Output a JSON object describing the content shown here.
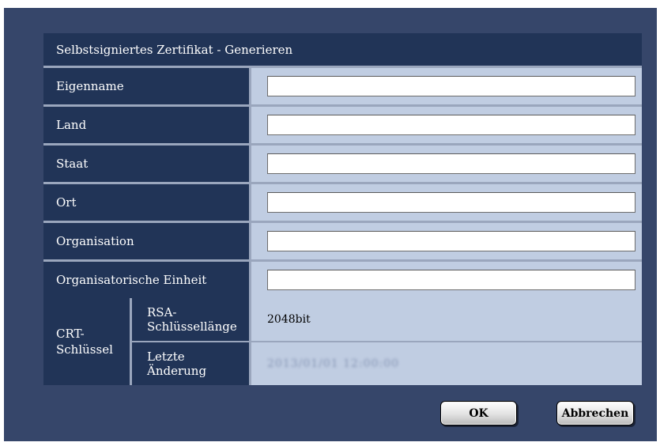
{
  "dialog": {
    "title": "Selbstsigniertes Zertifikat - Generieren"
  },
  "fields": [
    {
      "label": "Eigenname",
      "value": "",
      "placeholder": ""
    },
    {
      "label": "Land",
      "value": "",
      "placeholder": ""
    },
    {
      "label": "Staat",
      "value": "",
      "placeholder": ""
    },
    {
      "label": "Ort",
      "value": "",
      "placeholder": ""
    },
    {
      "label": "Organisation",
      "value": "",
      "placeholder": ""
    },
    {
      "label": "Organisatorische Einheit",
      "value": "",
      "placeholder": ""
    }
  ],
  "crt": {
    "label_line1": "CRT-",
    "label_line2": "Schlüssel",
    "rsa_label_line1": "RSA-",
    "rsa_label_line2": "Schlüssellänge",
    "rsa_value": "2048bit",
    "changed_label_line1": "Letzte",
    "changed_label_line2": "Änderung",
    "changed_value": "2013/01/01 12:00:00"
  },
  "buttons": {
    "ok": "OK",
    "cancel": "Abbrechen"
  },
  "colors": {
    "dialog_bg": "#36466a",
    "label_bg": "#213457",
    "value_bg": "#c0cde2"
  }
}
